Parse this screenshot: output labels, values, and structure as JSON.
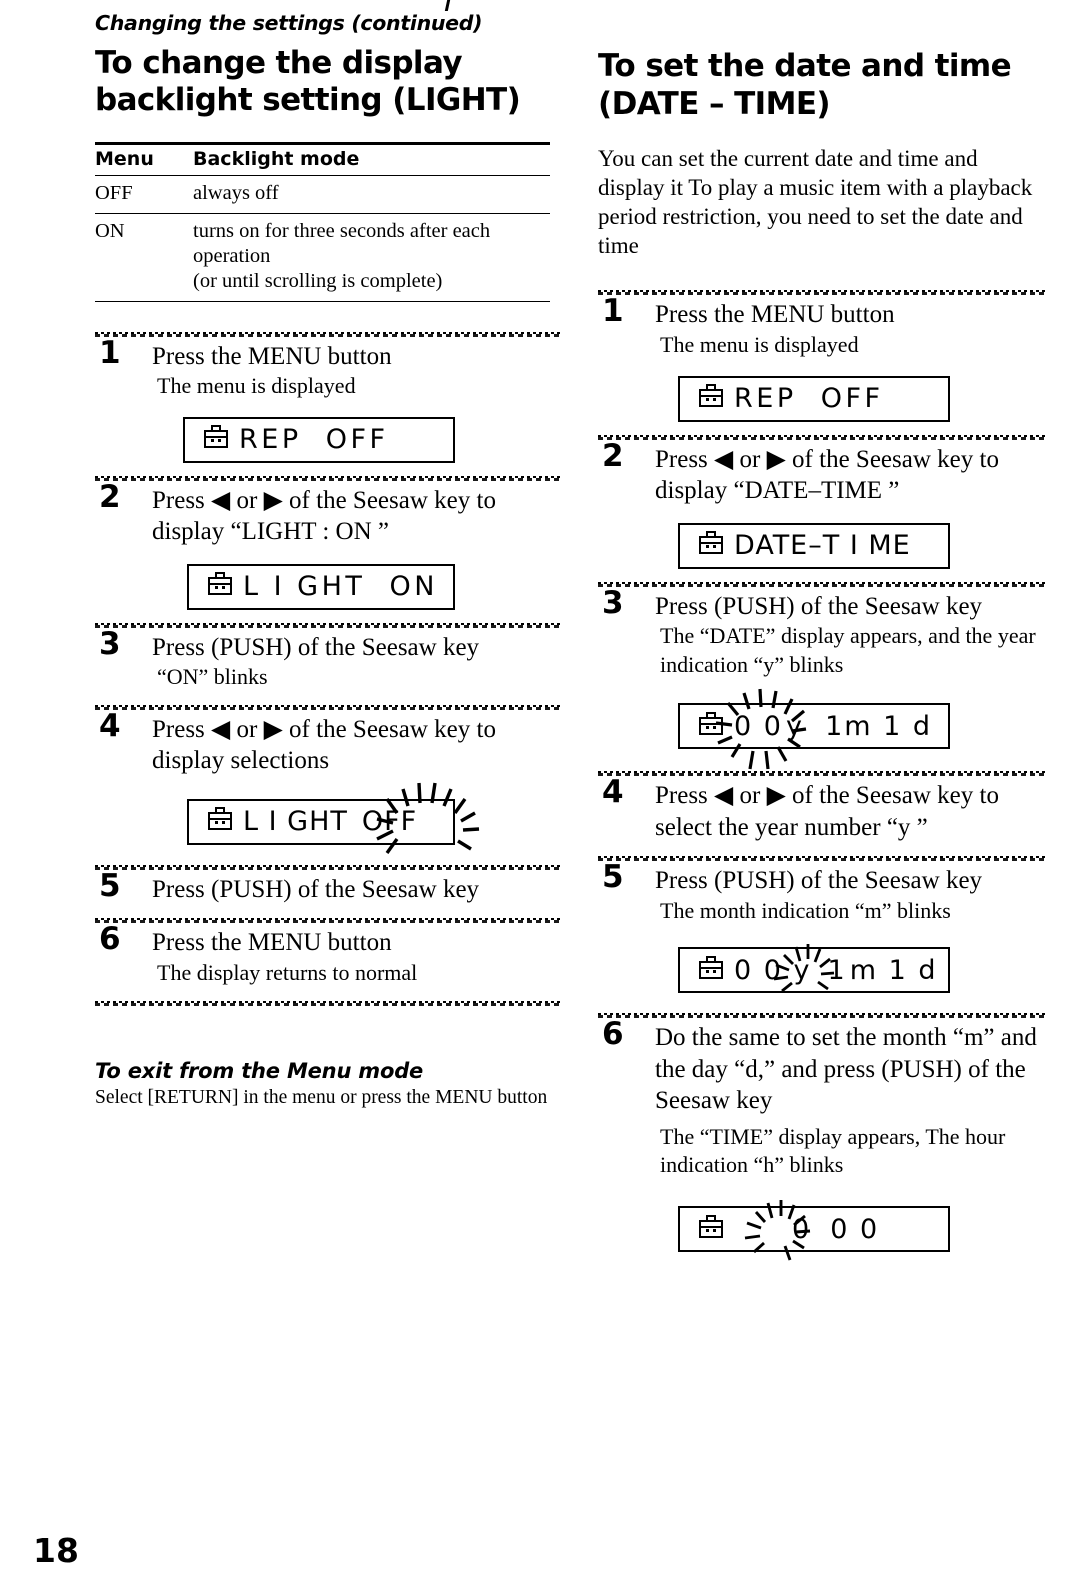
{
  "document": {
    "running_head": "Changing the settings (continued)",
    "page_number": "18"
  },
  "left_column": {
    "title_line1": "To change the display",
    "title_line2": "backlight setting (LIGHT)",
    "table": {
      "headers": [
        "Menu",
        "Backlight mode"
      ],
      "rows": [
        {
          "menu": "OFF",
          "mode": "always off"
        },
        {
          "menu": "ON",
          "mode": "turns on for three seconds after each operation\n(or until scrolling is complete)"
        }
      ]
    },
    "steps": [
      {
        "number": "1",
        "main": "Press the MENU button",
        "sub": "The menu is displayed",
        "display": {
          "icon": "briefcase-icon",
          "text": "REP  OFF"
        }
      },
      {
        "number": "2",
        "main": "Press ◀ or ▶ of the Seesaw key to display “LIGHT : ON ”",
        "sub": "",
        "display": {
          "icon": "briefcase-icon",
          "text": "L I GHT  ON"
        }
      },
      {
        "number": "3",
        "main": "Press (PUSH) of the Seesaw key",
        "sub": "“ON” blinks",
        "display": null
      },
      {
        "number": "4",
        "main": "Press ◀ or ▶ of the Seesaw key to display selections",
        "sub": "",
        "display": {
          "icon": "briefcase-icon",
          "text_static": "L I GHT",
          "text_blinking": "OFF"
        }
      },
      {
        "number": "5",
        "main": "Press (PUSH) of the Seesaw key",
        "sub": "",
        "display": null
      },
      {
        "number": "6",
        "main": "Press the MENU button",
        "sub": "The display returns to normal",
        "display": null
      }
    ],
    "exit_section": {
      "heading": "To exit from the Menu mode",
      "body": "Select [RETURN] in the menu or press the MENU button"
    }
  },
  "right_column": {
    "title_line1": "To set the date and time",
    "title_line2": "(DATE – TIME)",
    "intro": "You can set the current date and time and display it  To play a music item with a playback period restriction, you need to set the date and time",
    "steps": [
      {
        "number": "1",
        "main": "Press the MENU button",
        "sub": "The menu is displayed",
        "display": {
          "icon": "briefcase-icon",
          "text": "REP  OFF"
        }
      },
      {
        "number": "2",
        "main": "Press ◀ or ▶ of the Seesaw key to display “DATE–TIME ”",
        "sub": "",
        "display": {
          "icon": "briefcase-icon",
          "text": "DATE–T I ME"
        }
      },
      {
        "number": "3",
        "main": "Press (PUSH) of the Seesaw key",
        "sub": "The “DATE” display appears, and the year indication “y” blinks",
        "display": {
          "icon": "briefcase-icon",
          "blink_value": "0 0",
          "after": "y  1m 1 d"
        }
      },
      {
        "number": "4",
        "main": "Press ◀ or ▶ of the Seesaw key to select the year number “y ”",
        "sub": "",
        "display": null
      },
      {
        "number": "5",
        "main": "Press (PUSH) of the Seesaw key",
        "sub": "The month indication “m” blinks",
        "display": {
          "icon": "briefcase-icon",
          "before": "0 0 y",
          "blink_value": "1",
          "after": "m 1 d"
        }
      },
      {
        "number": "6",
        "main": "Do the same to set the month “m” and the day “d,” and press (PUSH) of the Seesaw key",
        "sub": "The “TIME” display appears, The hour indication “h” blinks",
        "display": {
          "icon": "briefcase-icon",
          "blink_value": "0",
          "after": "0 0"
        }
      }
    ]
  }
}
